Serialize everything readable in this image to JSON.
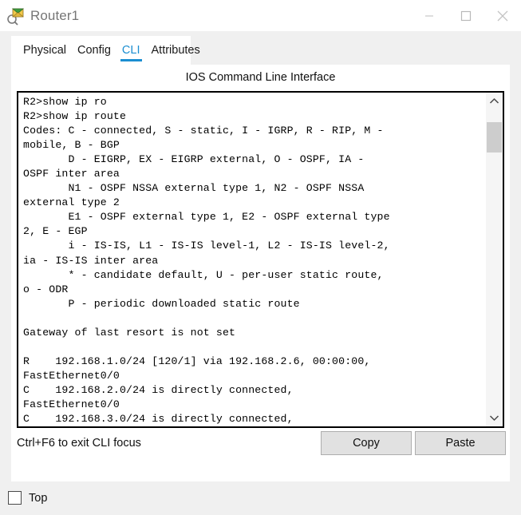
{
  "window": {
    "title": "Router1",
    "icon": "router-magnifier-icon",
    "controls": {
      "minimize": "minimize-icon",
      "maximize": "maximize-icon",
      "close": "close-icon"
    }
  },
  "tabs": [
    {
      "label": "Physical",
      "active": false
    },
    {
      "label": "Config",
      "active": false
    },
    {
      "label": "CLI",
      "active": true
    },
    {
      "label": "Attributes",
      "active": false
    }
  ],
  "panel": {
    "header": "IOS Command Line Interface",
    "hint": "Ctrl+F6 to exit CLI focus",
    "copy_label": "Copy",
    "paste_label": "Paste"
  },
  "terminal": {
    "lines": [
      "R2>show ip ro",
      "R2>show ip route",
      "Codes: C - connected, S - static, I - IGRP, R - RIP, M -",
      "mobile, B - BGP",
      "       D - EIGRP, EX - EIGRP external, O - OSPF, IA -",
      "OSPF inter area",
      "       N1 - OSPF NSSA external type 1, N2 - OSPF NSSA",
      "external type 2",
      "       E1 - OSPF external type 1, E2 - OSPF external type",
      "2, E - EGP",
      "       i - IS-IS, L1 - IS-IS level-1, L2 - IS-IS level-2,",
      "ia - IS-IS inter area",
      "       * - candidate default, U - per-user static route,",
      "o - ODR",
      "       P - periodic downloaded static route",
      "",
      "Gateway of last resort is not set",
      "",
      "R    192.168.1.0/24 [120/1] via 192.168.2.6, 00:00:00,",
      "FastEthernet0/0",
      "C    192.168.2.0/24 is directly connected,",
      "FastEthernet0/0",
      "C    192.168.3.0/24 is directly connected,"
    ]
  },
  "scrollbar": {
    "up_arrow": "chevron-up-icon",
    "down_arrow": "chevron-down-icon"
  },
  "bottom": {
    "top_checkbox_label": "Top",
    "top_checkbox_checked": false
  },
  "colors": {
    "accent": "#1b8ed1",
    "title_text": "#767676",
    "window_bg": "#f0f0f0",
    "panel_bg": "#ffffff",
    "button_face": "#e1e1e1",
    "scroll_thumb": "#cdcdcd"
  }
}
